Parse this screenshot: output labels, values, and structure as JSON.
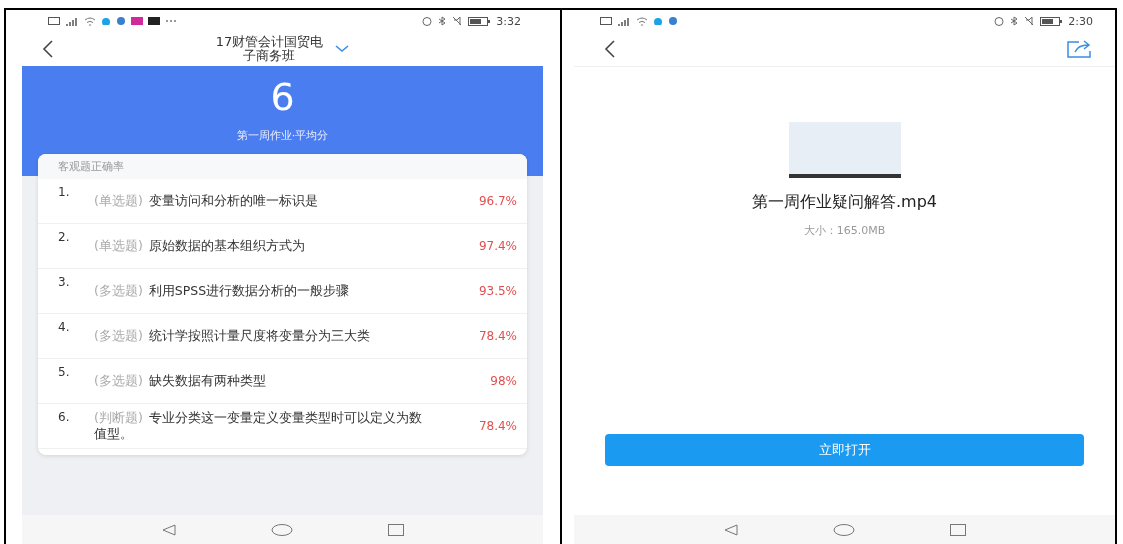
{
  "left_screen": {
    "status_bar": {
      "time": "3:32"
    },
    "header": {
      "title": "17财管会计国贸电子商务班"
    },
    "summary": {
      "score": "6",
      "label": "第一周作业·平均分"
    },
    "card": {
      "title": "客观题正确率",
      "questions": [
        {
          "number": "1.",
          "type": "(单选题)",
          "text": "变量访问和分析的唯一标识是",
          "rate": "96.7%"
        },
        {
          "number": "2.",
          "type": "(单选题)",
          "text": "原始数据的基本组织方式为",
          "rate": "97.4%"
        },
        {
          "number": "3.",
          "type": "(多选题)",
          "text": "利用SPSS进行数据分析的一般步骤",
          "rate": "93.5%"
        },
        {
          "number": "4.",
          "type": "(多选题)",
          "text": "统计学按照计量尺度将变量分为三大类",
          "rate": "78.4%"
        },
        {
          "number": "5.",
          "type": "(多选题)",
          "text": "缺失数据有两种类型",
          "rate": "98%"
        },
        {
          "number": "6.",
          "type": "(判断题)",
          "text": "专业分类这一变量定义变量类型时可以定义为数值型。",
          "rate": "78.4%"
        }
      ]
    }
  },
  "right_screen": {
    "status_bar": {
      "time": "2:30"
    },
    "file": {
      "name": "第一周作业疑问解答.mp4",
      "size": "大小：165.0MB"
    },
    "open_button": "立即打开"
  }
}
